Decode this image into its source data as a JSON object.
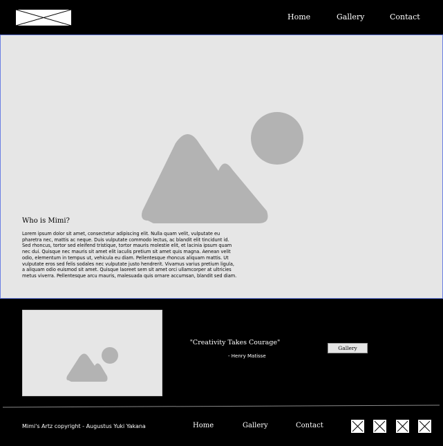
{
  "header": {
    "logo_icon": "logo-placeholder-icon",
    "nav": [
      {
        "label": "Home"
      },
      {
        "label": "Gallery"
      },
      {
        "label": "Contact"
      }
    ]
  },
  "hero": {
    "image_icon": "image-placeholder-icon",
    "title": "Who is Mimi?",
    "text": "Lorem ipsum dolor sit amet, consectetur adipiscing elit. Nulla quam velit, vulputate eu pharetra nec, mattis ac neque. Duis vulputate commodo lectus, ac blandit elit tincidunt id. Sed rhoncus, tortor sed eleifend tristique, tortor mauris molestie elit, et lacinia ipsum quam nec dui. Quisque nec mauris sit amet elit iaculis pretium sit amet quis magna. Aenean velit odio, elementum in tempus ut, vehicula eu diam. Pellentesque rhoncus aliquam mattis. Ut vulputate eros sed felis sodales nec vulputate justo hendrerit. Vivamus varius pretium ligula, a aliquam odio euismod sit amet. Quisque laoreet sem sit amet orci ullamcorper at ultricies metus viverra. Pellentesque arcu mauris, malesuada quis ornare accumsan, blandit sed diam."
  },
  "feature": {
    "image_icon": "image-placeholder-icon",
    "quote": "\"Creativity Takes Courage\"",
    "author": "- Henry Matisse",
    "button_label": "Gallery"
  },
  "footer": {
    "copyright": "Mimi's Artz copyright - Augustus Yuki Yakana",
    "nav": [
      {
        "label": "Home"
      },
      {
        "label": "Gallery"
      },
      {
        "label": "Contact"
      }
    ],
    "social_icons": [
      "social-placeholder-icon",
      "social-placeholder-icon",
      "social-placeholder-icon",
      "social-placeholder-icon"
    ]
  },
  "colors": {
    "background": "#000000",
    "panel": "#e6e6e6",
    "placeholder_shape": "#b3b3b3",
    "hero_border": "#6b7fe3"
  }
}
